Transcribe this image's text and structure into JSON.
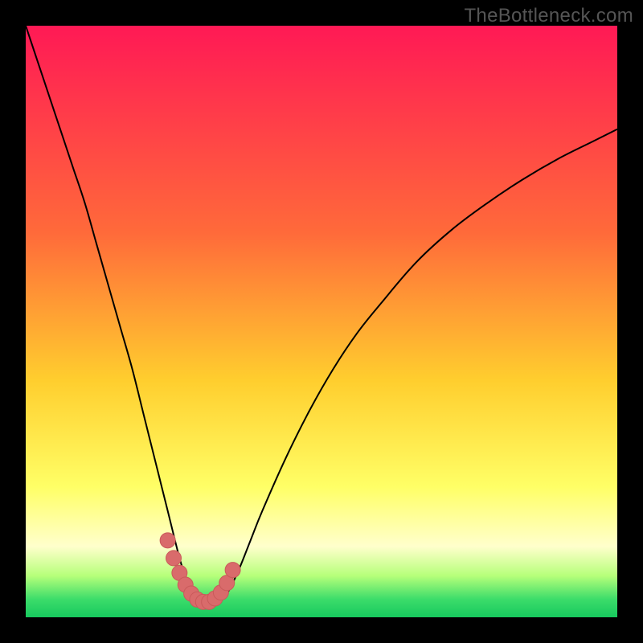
{
  "watermark": "TheBottleneck.com",
  "colors": {
    "frame": "#000000",
    "curve_stroke": "#000000",
    "marker_fill": "#d96b6b",
    "marker_stroke": "#c95a5a",
    "grad_top": "#ff1955",
    "grad_mid1": "#ff6a3a",
    "grad_mid2": "#ffce2e",
    "grad_mid3": "#ffff66",
    "grad_pale": "#ffffcc",
    "grad_green1": "#b6ff7a",
    "grad_green2": "#3bdc6a",
    "grad_green3": "#17c95e"
  },
  "chart_data": {
    "type": "line",
    "title": "",
    "xlabel": "",
    "ylabel": "",
    "xlim": [
      0,
      100
    ],
    "ylim": [
      0,
      100
    ],
    "series": [
      {
        "name": "bottleneck-curve",
        "x": [
          0,
          2,
          4,
          6,
          8,
          10,
          12,
          14,
          16,
          18,
          20,
          22,
          24,
          26,
          27,
          28,
          29,
          30,
          31,
          32,
          34,
          36,
          38,
          40,
          44,
          48,
          52,
          56,
          60,
          66,
          72,
          78,
          84,
          90,
          96,
          100
        ],
        "y": [
          100,
          94,
          88,
          82,
          76,
          70,
          63,
          56,
          49,
          42,
          34,
          26,
          18,
          10,
          7,
          4.5,
          3,
          2.2,
          2,
          2.3,
          4,
          8,
          13,
          18,
          27,
          35,
          42,
          48,
          53,
          60,
          65.5,
          70,
          74,
          77.5,
          80.5,
          82.5
        ]
      }
    ],
    "markers": {
      "name": "trough-markers",
      "x": [
        24,
        25,
        26,
        27,
        28,
        29,
        30,
        31,
        32,
        33,
        34,
        35
      ],
      "y": [
        13,
        10,
        7.5,
        5.5,
        4,
        3,
        2.6,
        2.6,
        3.2,
        4.2,
        5.8,
        8
      ]
    },
    "background_gradient_stops": [
      {
        "offset": 0.0,
        "color_key": "grad_top"
      },
      {
        "offset": 0.35,
        "color_key": "grad_mid1"
      },
      {
        "offset": 0.6,
        "color_key": "grad_mid2"
      },
      {
        "offset": 0.78,
        "color_key": "grad_mid3"
      },
      {
        "offset": 0.88,
        "color_key": "grad_pale"
      },
      {
        "offset": 0.93,
        "color_key": "grad_green1"
      },
      {
        "offset": 0.97,
        "color_key": "grad_green2"
      },
      {
        "offset": 1.0,
        "color_key": "grad_green3"
      }
    ]
  }
}
